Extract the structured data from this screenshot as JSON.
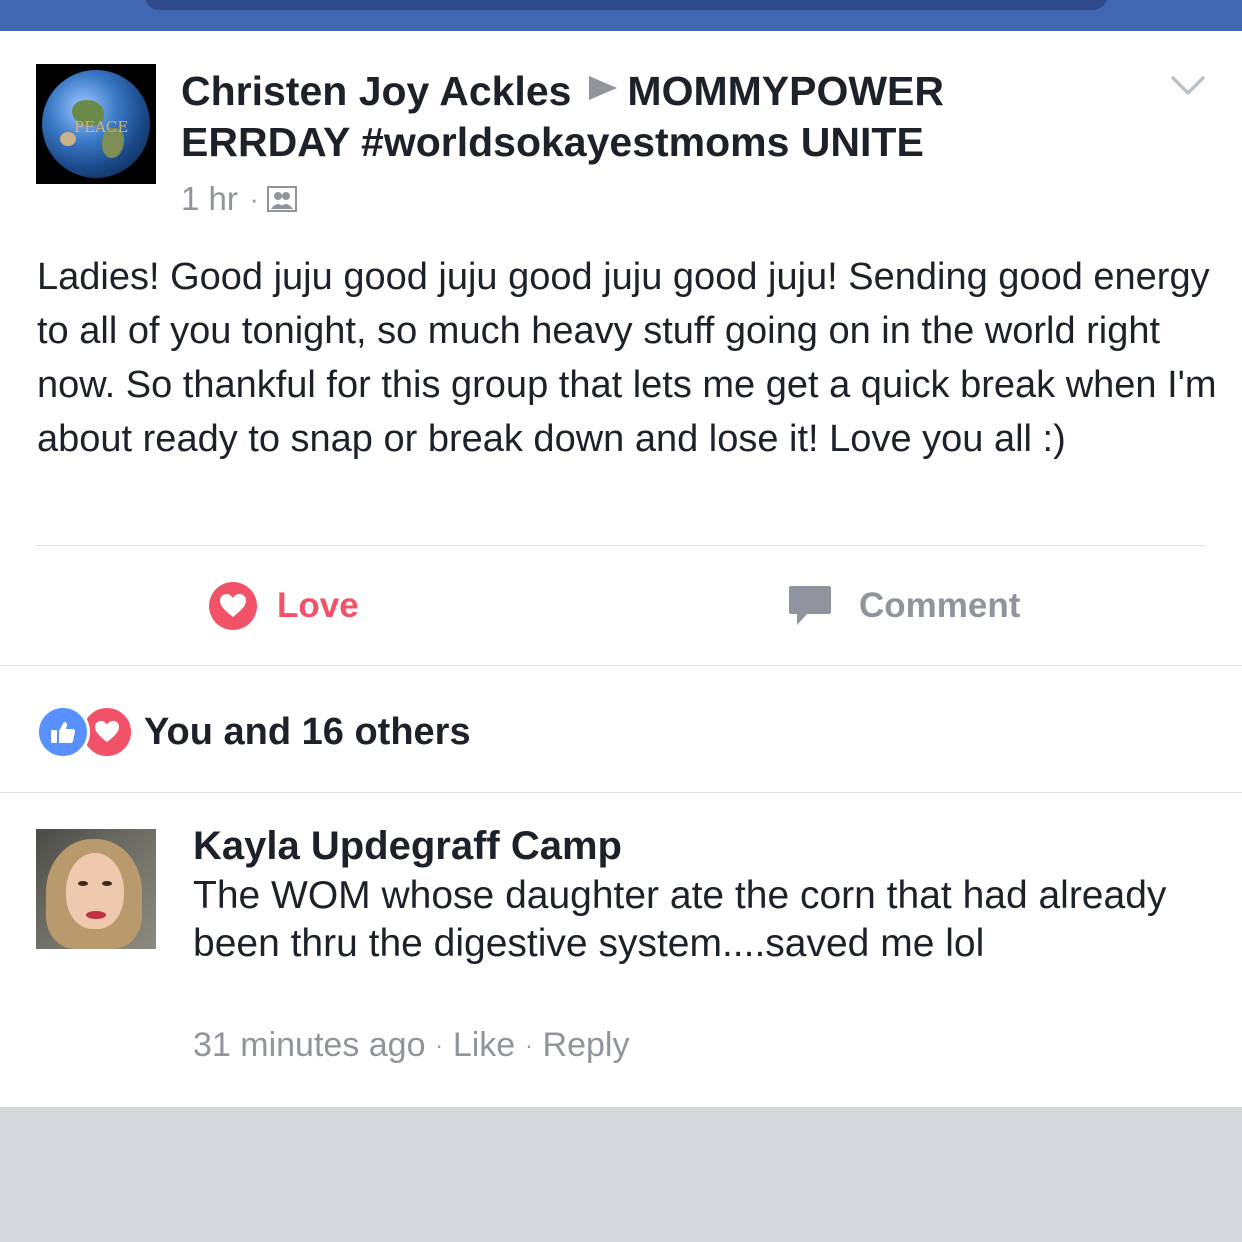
{
  "colors": {
    "brand_blue": "#4267b2",
    "love_red": "#f25268",
    "like_blue": "#5890ff",
    "muted_gray": "#90949c",
    "text_dark": "#1d2129"
  },
  "post": {
    "author": "Christen Joy Ackles",
    "group": "MOMMYPOWER ERRDAY #worldsokayestmoms UNITE",
    "timestamp": "1 hr",
    "separator": "·",
    "audience_icon": "group-icon",
    "avatar_icon": "earth-peace-icon",
    "avatar_text": "PEACE",
    "options_icon": "chevron-down-icon",
    "body": "Ladies! Good juju good juju good juju good juju!  Sending good energy to all of you tonight, so much heavy stuff going on in the world right now. So thankful for this group that lets me get a quick break when I'm about ready to snap or break down and lose it! Love you all :)"
  },
  "actions": {
    "love_label": "Love",
    "love_icon": "heart-icon",
    "comment_label": "Comment",
    "comment_icon": "comment-bubble-icon"
  },
  "reactions": {
    "icons": [
      "like-icon",
      "heart-icon"
    ],
    "summary": "You and 16 others"
  },
  "comment": {
    "author": "Kayla Updegraff Camp",
    "text": "The WOM whose daughter ate the corn that had already been thru the digestive system....saved me lol",
    "time": "31 minutes ago",
    "like_label": "Like",
    "reply_label": "Reply",
    "separator": "·"
  }
}
